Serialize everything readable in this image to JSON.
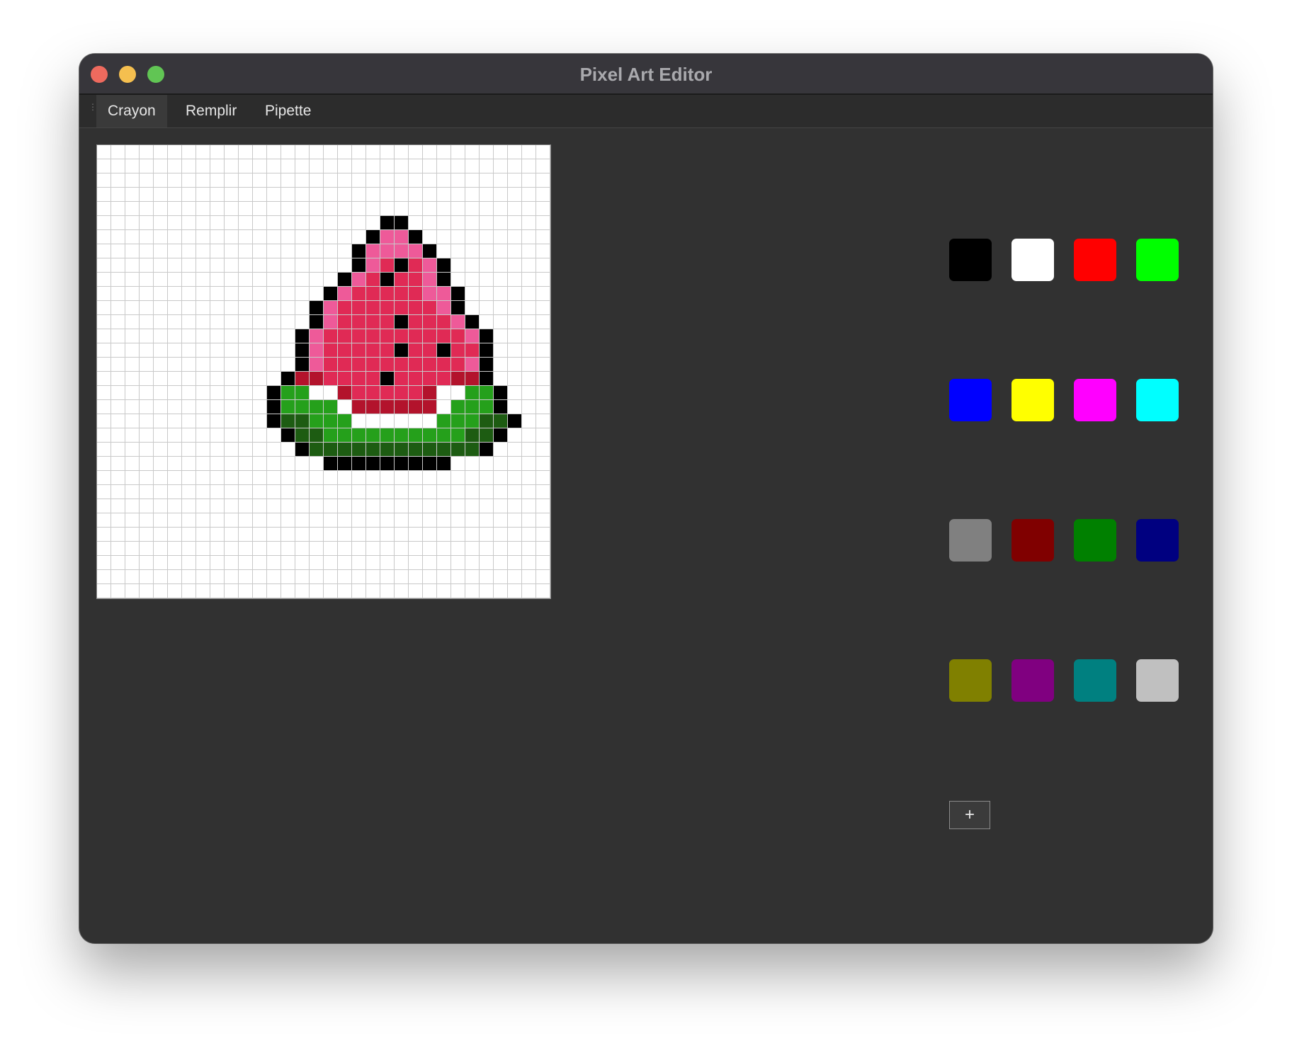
{
  "window": {
    "title": "Pixel Art Editor",
    "traffic_lights": [
      "close",
      "minimize",
      "maximize"
    ]
  },
  "toolbar": {
    "tabs": [
      {
        "label": "Crayon",
        "active": true
      },
      {
        "label": "Remplir",
        "active": false
      },
      {
        "label": "Pipette",
        "active": false
      }
    ]
  },
  "canvas": {
    "columns": 32,
    "rows": 32,
    "legend": {
      "K": "#000000",
      "P": "#ee5a99",
      "R": "#e02a55",
      "D": "#b3132c",
      "G": "#25a01b",
      "E": "#1d5c12",
      "W": "#ffffff"
    },
    "pixels": [
      "................................",
      "................................",
      "................................",
      "................................",
      "................................",
      "....................KK..........",
      "...................KPPK.........",
      "..................KPPPPK........",
      "..................KPRKRPK.......",
      ".................KPRKRRPK.......",
      "................KPRRRRRPPK......",
      "...............KPRRRRRRRPK......",
      "...............KPRRRRKRRRPK.....",
      "..............KPRRRRRRRRRRPK....",
      "..............KPRRRRRKRRKRRK....",
      "..............KPRRRRRRRRRRPK....",
      ".............KDDRRRRKRRRRDDK....",
      "............KGGWWDRRRRRDWWGGK...",
      "............KGGGGWDDDDDDWGGGK...",
      "............KEEGGGWWWWWWGGGEEK..",
      ".............KEEGGGGGGGGGGEEK...",
      "..............KEEEEEEEEEEEEK....",
      "................KKKKKKKKK.......",
      "................................",
      "................................",
      "................................",
      "................................",
      "................................",
      "................................",
      "................................",
      "................................",
      "................................"
    ]
  },
  "palette": {
    "colors": [
      "#000000",
      "#ffffff",
      "#ff0000",
      "#00ff00",
      "#0000ff",
      "#ffff00",
      "#ff00ff",
      "#00ffff",
      "#808080",
      "#800000",
      "#008000",
      "#000080",
      "#808000",
      "#800080",
      "#008080",
      "#c0c0c0"
    ],
    "add_button_label": "+"
  }
}
